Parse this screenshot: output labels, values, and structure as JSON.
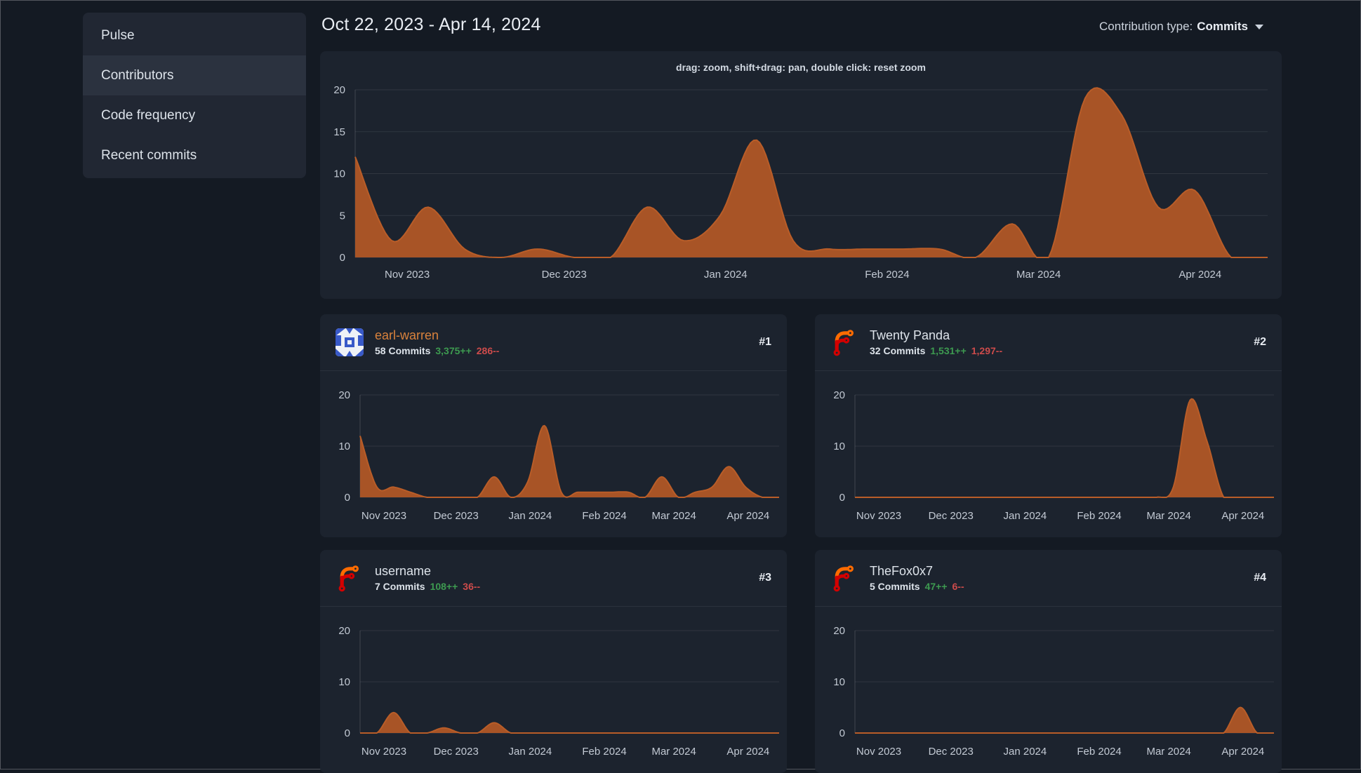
{
  "colors": {
    "page-bg": "#141a23",
    "frame-border": "#53565e",
    "menu-bg": "#212733",
    "menu-active": "#2b323f",
    "card-bg": "#1c232e",
    "divider": "#2a313d",
    "text": "#dde3ea",
    "heading": "#e9edf3",
    "muted": "#ccd3dd",
    "hint": "#d2d9e2",
    "axis-text": "#c3cad4",
    "grid": "rgba(255,255,255,0.09)",
    "grid-strong": "rgba(255,255,255,0.16)",
    "chart-fill": "#a85426",
    "chart-stroke": "#b95d28",
    "link-orange": "#d9823c",
    "green": "#3d9a50",
    "red": "#cd4b4b",
    "identicon-blue": "#3859c8",
    "forgejo-orange": "#ff6b00",
    "forgejo-red": "#d40000"
  },
  "sidebar": {
    "items": [
      {
        "label": "Pulse",
        "active": false
      },
      {
        "label": "Contributors",
        "active": true
      },
      {
        "label": "Code frequency",
        "active": false
      },
      {
        "label": "Recent commits",
        "active": false
      }
    ]
  },
  "header": {
    "date_range": "Oct 22, 2023 - Apr 14, 2024",
    "contribution_type_label": "Contribution type:",
    "contribution_type_value": "Commits"
  },
  "main_chart": {
    "hint": "drag: zoom, shift+drag: pan, double click: reset zoom"
  },
  "contributors": [
    {
      "rank": "#1",
      "name": "earl-warren",
      "commits": "58 Commits",
      "additions": "3,375++",
      "deletions": "286--",
      "avatar": "identicon"
    },
    {
      "rank": "#2",
      "name": "Twenty Panda",
      "commits": "32 Commits",
      "additions": "1,531++",
      "deletions": "1,297--",
      "avatar": "forgejo"
    },
    {
      "rank": "#3",
      "name": "username",
      "commits": "7 Commits",
      "additions": "108++",
      "deletions": "36--",
      "avatar": "forgejo"
    },
    {
      "rank": "#4",
      "name": "TheFox0x7",
      "commits": "5 Commits",
      "additions": "47++",
      "deletions": "6--",
      "avatar": "forgejo"
    }
  ],
  "chart_data": [
    {
      "id": "overall-weekly-commits",
      "type": "area",
      "x_start": "2023-10-22",
      "x_end": "2024-04-14",
      "x_unit": "week",
      "values": [
        12,
        2,
        6,
        1,
        0,
        1,
        0,
        0,
        6,
        2,
        5,
        14,
        2,
        1,
        1,
        1,
        1,
        0,
        4,
        0,
        19,
        17,
        6,
        8,
        0,
        0
      ],
      "ylim": [
        0,
        20
      ],
      "yticks": [
        0,
        5,
        10,
        15,
        20
      ],
      "xticks": [
        "Nov 2023",
        "Dec 2023",
        "Jan 2024",
        "Feb 2024",
        "Mar 2024",
        "Apr 2024"
      ],
      "xtick_fractions": [
        0.057,
        0.229,
        0.406,
        0.583,
        0.749,
        0.926
      ],
      "grid": true,
      "legend": "none"
    },
    {
      "id": "earl-warren-weekly-commits",
      "type": "area",
      "values": [
        12,
        2,
        2,
        1,
        0,
        0,
        0,
        0,
        4,
        0,
        3,
        14,
        1,
        1,
        1,
        1,
        1,
        0,
        4,
        0,
        1,
        2,
        6,
        2,
        0,
        0
      ],
      "ylim": [
        0,
        20
      ],
      "yticks": [
        0,
        10,
        20
      ],
      "xticks": [
        "Nov 2023",
        "Dec 2023",
        "Jan 2024",
        "Feb 2024",
        "Mar 2024",
        "Apr 2024"
      ],
      "xtick_fractions": [
        0.057,
        0.229,
        0.406,
        0.583,
        0.749,
        0.926
      ],
      "grid": true,
      "legend": "none"
    },
    {
      "id": "twenty-panda-weekly-commits",
      "type": "area",
      "values": [
        0,
        0,
        0,
        0,
        0,
        0,
        0,
        0,
        0,
        0,
        0,
        0,
        0,
        0,
        0,
        0,
        0,
        0,
        0,
        2,
        19,
        11,
        0,
        0,
        0,
        0
      ],
      "ylim": [
        0,
        20
      ],
      "yticks": [
        0,
        10,
        20
      ],
      "xticks": [
        "Nov 2023",
        "Dec 2023",
        "Jan 2024",
        "Feb 2024",
        "Mar 2024",
        "Apr 2024"
      ],
      "xtick_fractions": [
        0.057,
        0.229,
        0.406,
        0.583,
        0.749,
        0.926
      ],
      "grid": true,
      "legend": "none"
    },
    {
      "id": "username-weekly-commits",
      "type": "area",
      "values": [
        0,
        0,
        4,
        0,
        0,
        1,
        0,
        0,
        2,
        0,
        0,
        0,
        0,
        0,
        0,
        0,
        0,
        0,
        0,
        0,
        0,
        0,
        0,
        0,
        0,
        0
      ],
      "ylim": [
        0,
        20
      ],
      "yticks": [
        0,
        10,
        20
      ],
      "xticks": [
        "Nov 2023",
        "Dec 2023",
        "Jan 2024",
        "Feb 2024",
        "Mar 2024",
        "Apr 2024"
      ],
      "xtick_fractions": [
        0.057,
        0.229,
        0.406,
        0.583,
        0.749,
        0.926
      ],
      "grid": true,
      "legend": "none"
    },
    {
      "id": "thefox0x7-weekly-commits",
      "type": "area",
      "values": [
        0,
        0,
        0,
        0,
        0,
        0,
        0,
        0,
        0,
        0,
        0,
        0,
        0,
        0,
        0,
        0,
        0,
        0,
        0,
        0,
        0,
        0,
        0,
        5,
        0,
        0
      ],
      "ylim": [
        0,
        20
      ],
      "yticks": [
        0,
        10,
        20
      ],
      "xticks": [
        "Nov 2023",
        "Dec 2023",
        "Jan 2024",
        "Feb 2024",
        "Mar 2024",
        "Apr 2024"
      ],
      "xtick_fractions": [
        0.057,
        0.229,
        0.406,
        0.583,
        0.749,
        0.926
      ],
      "grid": true,
      "legend": "none"
    }
  ]
}
